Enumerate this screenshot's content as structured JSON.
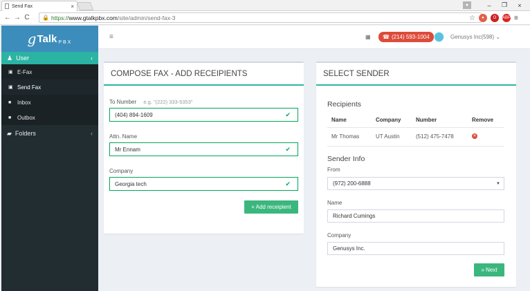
{
  "browser": {
    "tab_title": "Send Fax",
    "url_scheme": "https://",
    "url_host": "www.gtalkpbx.com",
    "url_path": "/site/admin/send-fax-3"
  },
  "brand": {
    "logo_g": "g",
    "logo_talk": "Talk",
    "logo_pbx": "PBX",
    "accent": "#2bb3a3"
  },
  "sidebar": {
    "section": "User",
    "items": [
      {
        "label": "E-Fax",
        "icon": "fax-icon"
      },
      {
        "label": "Send Fax",
        "icon": "fax-icon"
      },
      {
        "label": "Inbox",
        "icon": "folder-icon"
      },
      {
        "label": "Outbox",
        "icon": "folder-icon"
      }
    ],
    "folders_label": "Folders"
  },
  "topbar": {
    "phone": "(214) 593-1004",
    "account": "Genusys Inc(598)"
  },
  "compose": {
    "title": "COMPOSE FAX - ADD RECEIPIENTS",
    "to_label": "To Number",
    "to_hint": "e.g. \"(222) 333-5353\"",
    "to_value": "(404) 894-1609",
    "attn_label": "Attn. Name",
    "attn_value": "Mr Ennam",
    "company_label": "Company",
    "company_value": "Georgia tech",
    "add_button": "+ Add receipient"
  },
  "sender": {
    "title": "SELECT SENDER",
    "recipients_heading": "Recipients",
    "columns": [
      "Name",
      "Company",
      "Number",
      "Remove"
    ],
    "rows": [
      {
        "name": "Mr Thomas",
        "company": "UT Austin",
        "number": "(512) 475-7478"
      }
    ],
    "info_heading": "Sender Info",
    "from_label": "From",
    "from_value": "(972) 200-6888",
    "name_label": "Name",
    "name_value": "Richard Cumings",
    "company_label": "Company",
    "company_value": "Genusys Inc.",
    "next_button": "» Next"
  }
}
